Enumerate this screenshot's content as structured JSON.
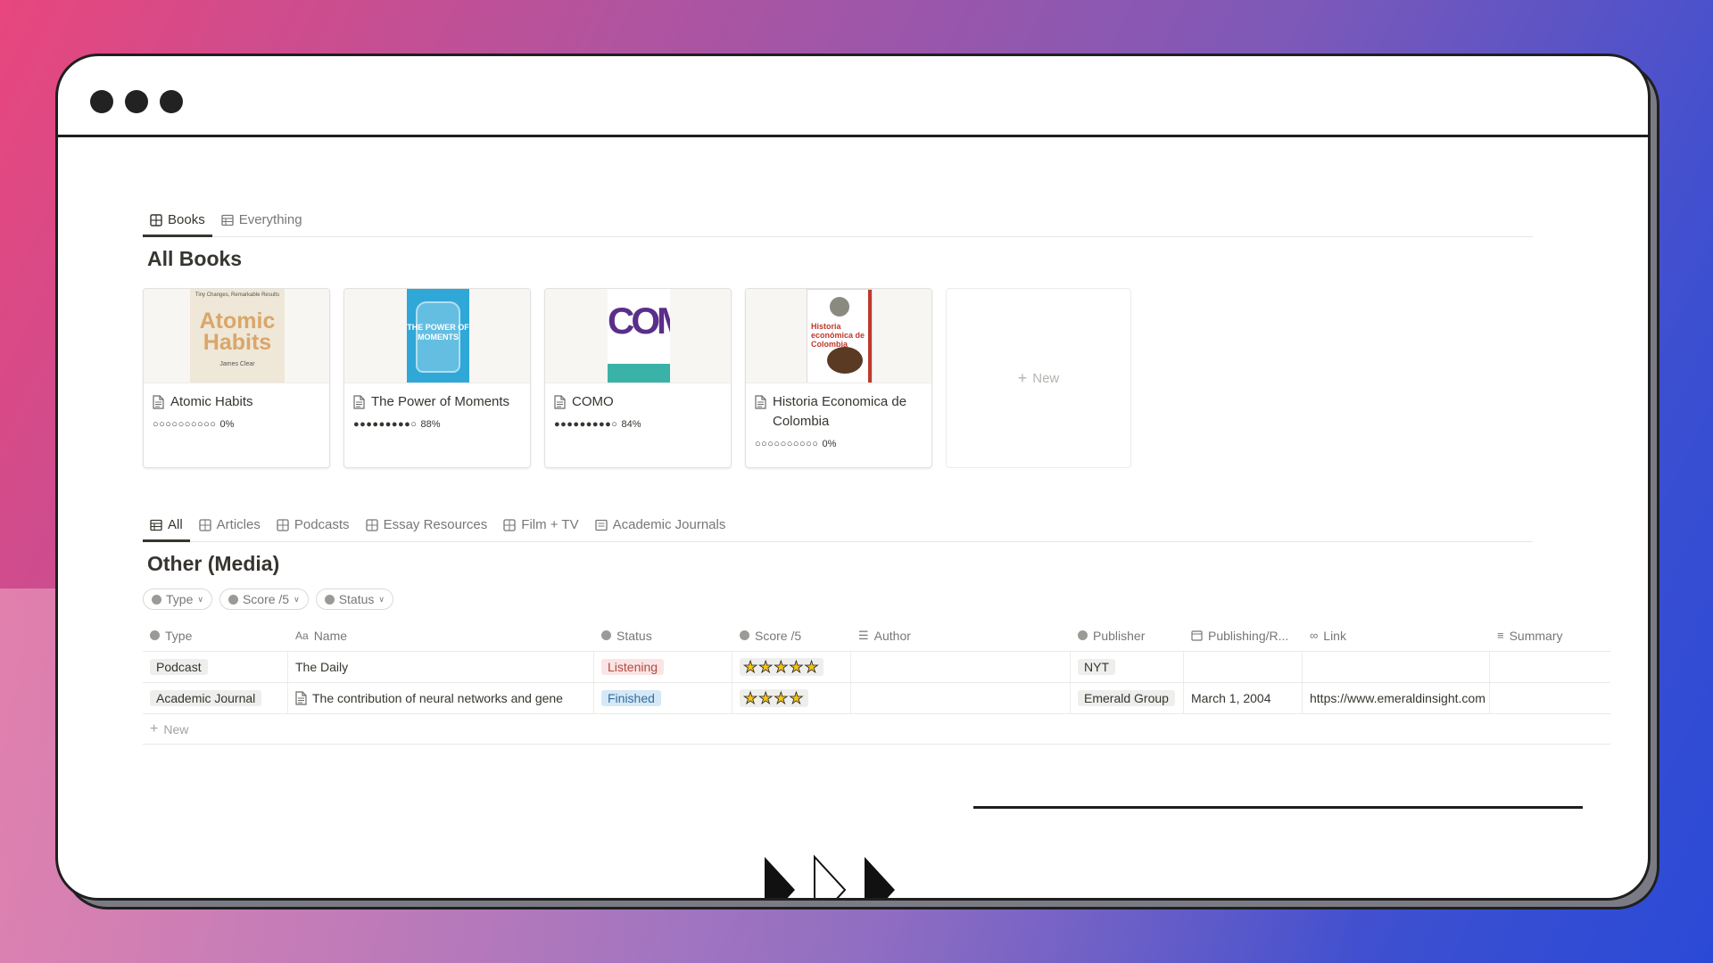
{
  "top_tabs": [
    {
      "label": "Books",
      "active": true,
      "icon": "gallery-icon"
    },
    {
      "label": "Everything",
      "active": false,
      "icon": "table-icon"
    }
  ],
  "books_section": {
    "title": "All Books",
    "cards": [
      {
        "title": "Atomic Habits",
        "progress_dots": "○○○○○○○○○○",
        "progress": "0%"
      },
      {
        "title": "The Power of Moments",
        "progress_dots": "●●●●●●●●●○",
        "progress": "88%"
      },
      {
        "title": "COMO",
        "progress_dots": "●●●●●●●●●○",
        "progress": "84%"
      },
      {
        "title": "Historia Economica de Colombia",
        "progress_dots": "○○○○○○○○○○",
        "progress": "0%"
      }
    ],
    "new_label": "New",
    "covers": {
      "atomic_top": "Tiny Changes, Remarkable Results",
      "atomic_title": "Atomic Habits",
      "atomic_author": "James Clear",
      "power_title": "THE POWER OF MOMENTS",
      "como_title": "COMO",
      "historia_title": "Historia económica de Colombia"
    }
  },
  "media_tabs": [
    {
      "label": "All",
      "active": true
    },
    {
      "label": "Articles",
      "active": false
    },
    {
      "label": "Podcasts",
      "active": false
    },
    {
      "label": "Essay Resources",
      "active": false
    },
    {
      "label": "Film + TV",
      "active": false
    },
    {
      "label": "Academic Journals",
      "active": false
    }
  ],
  "media_section": {
    "title": "Other (Media)",
    "filters": [
      "Type",
      "Score /5",
      "Status"
    ],
    "columns": [
      "Type",
      "Name",
      "Status",
      "Score /5",
      "Author",
      "Publisher",
      "Publishing/R...",
      "Link",
      "Summary"
    ],
    "rows": [
      {
        "type": "Podcast",
        "name": "The Daily",
        "status": "Listening",
        "score": "★★★★★",
        "author": "",
        "publisher": "NYT",
        "date": "",
        "link": "",
        "summary": ""
      },
      {
        "type": "Academic Journal",
        "name": "The contribution of neural networks and gene",
        "status": "Finished",
        "score": "★★★★",
        "author": "",
        "publisher": "Emerald Group",
        "date": "March 1, 2004",
        "link": "https://www.emeraldinsight.com",
        "summary": ""
      }
    ],
    "new_label": "New"
  },
  "colors": {
    "listening_bg": "#fbe4e4",
    "finished_bg": "#d6e8f5",
    "star": "#f3c316"
  }
}
